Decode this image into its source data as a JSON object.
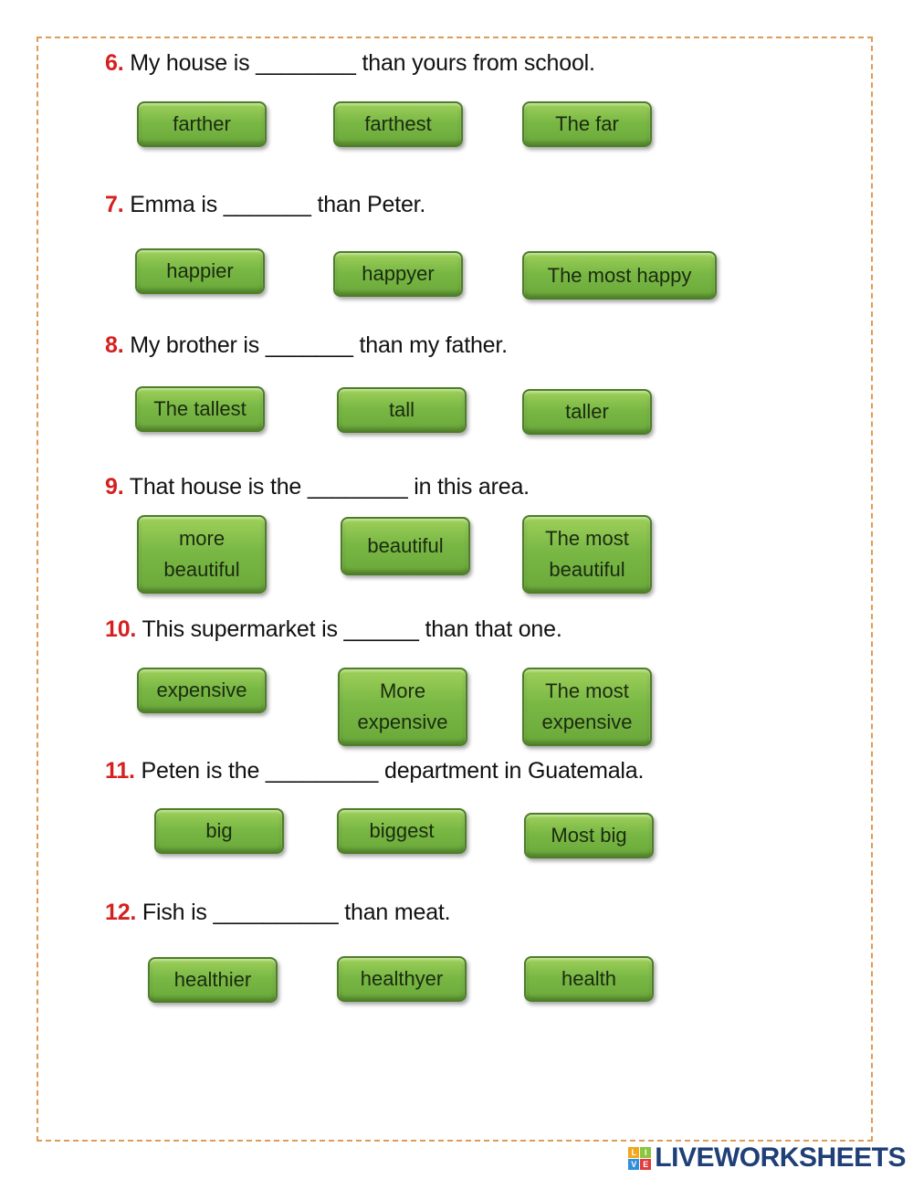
{
  "questions": [
    {
      "num": "6.",
      "text": " My house is ________ than yours from school.",
      "options": [
        "farther",
        "farthest",
        "The far"
      ]
    },
    {
      "num": "7.",
      "text": " Emma is _______ than Peter.",
      "options": [
        "happier",
        "happyer",
        "The most happy"
      ]
    },
    {
      "num": "8.",
      "text": " My brother is _______ than my father.",
      "options": [
        "The tallest",
        "tall",
        "taller"
      ]
    },
    {
      "num": "9.",
      "text": " That house is the ________ in this area.",
      "options": [
        "more beautiful",
        "beautiful",
        "The most beautiful"
      ]
    },
    {
      "num": "10.",
      "text": "   This supermarket is ______ than that one.",
      "options": [
        "expensive",
        "More expensive",
        "The most expensive"
      ]
    },
    {
      "num": "11.",
      "text": "   Peten is the _________ department in Guatemala.",
      "options": [
        "big",
        "biggest",
        "Most big"
      ]
    },
    {
      "num": "12.",
      "text": "   Fish is __________ than meat.",
      "options": [
        "healthier",
        "healthyer",
        "health"
      ]
    }
  ],
  "logo": {
    "text": "LIVEWORKSHEETS",
    "blocks": [
      "L",
      "I",
      "V",
      "E"
    ]
  },
  "colors": {
    "number": "#d61f1f",
    "button": "#7ab845",
    "border": "#e09a5a",
    "logo": "#1f3f77"
  }
}
